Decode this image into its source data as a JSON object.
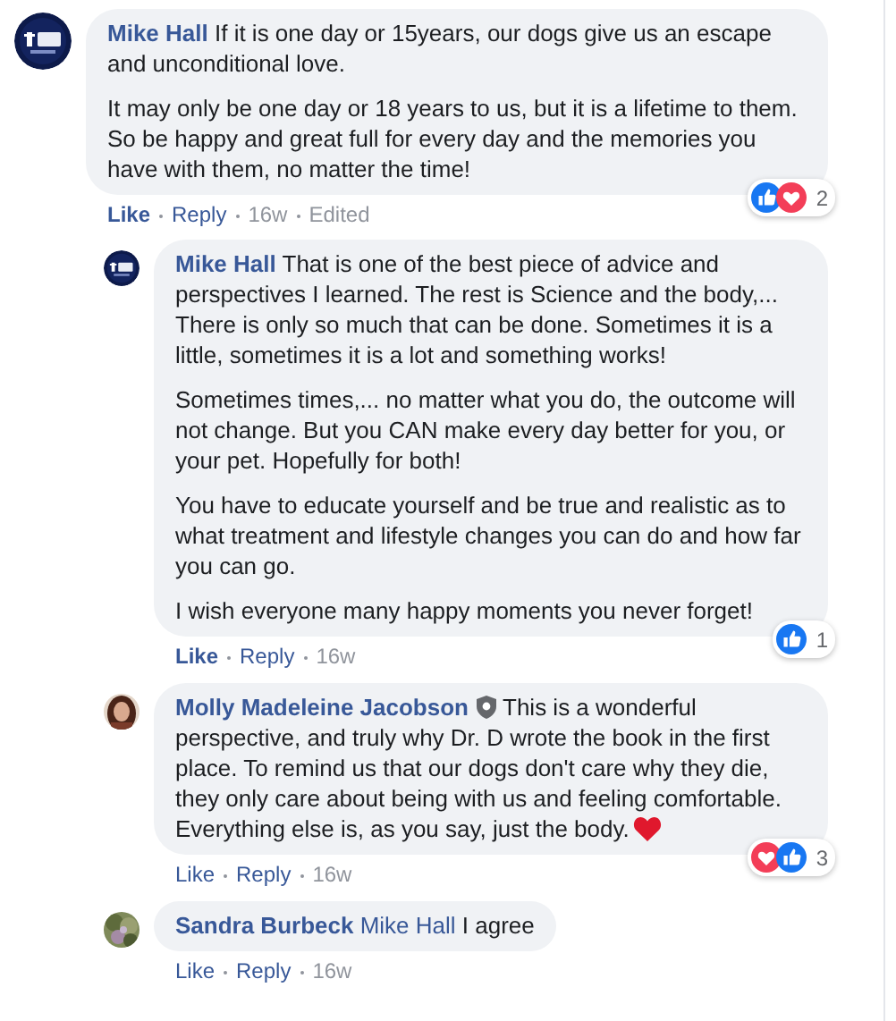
{
  "comments": [
    {
      "author": "Mike Hall",
      "avatar": {
        "kind": "logo"
      },
      "paragraphs": [
        "If it is one day or 15years, our dogs give us an escape and unconditional love.",
        "It may only be one day or 18 years to us, but it is a lifetime to them. So be happy and great full for every day and the memories you have with them, no matter the time!"
      ],
      "reactions": [
        {
          "kind": "like"
        },
        {
          "kind": "love"
        }
      ],
      "reaction_count": "2",
      "like_label": "Like",
      "liked": true,
      "reply_label": "Reply",
      "time": "16w",
      "edited": "Edited",
      "children": [
        {
          "author": "Mike Hall",
          "avatar": {
            "kind": "logo"
          },
          "paragraphs": [
            "That is one of the best piece of advice and perspectives I learned. The rest is Science and the body,... There is only so much that can be done. Sometimes it is a little, sometimes it is a lot and something works!",
            "Sometimes times,... no matter what you do, the outcome will not change. But you CAN make every day better for you, or your pet. Hopefully for both!",
            "You have to educate yourself and be true and realistic as to what treatment and lifestyle changes you can do and how far you can go.",
            "I wish everyone many happy moments you never forget!"
          ],
          "reactions": [
            {
              "kind": "like"
            }
          ],
          "reaction_count": "1",
          "like_label": "Like",
          "liked": true,
          "reply_label": "Reply",
          "time": "16w"
        },
        {
          "author": "Molly Madeleine Jacobson",
          "avatar": {
            "kind": "picture"
          },
          "badge": true,
          "paragraphs": [
            "This is a wonderful perspective, and truly why Dr. D wrote the book in the first place. To remind us that our dogs don't care why they die, they only care about being with us and feeling comfortable. Everything else is, as you say, just the body."
          ],
          "ends_with_heart": true,
          "reactions": [
            {
              "kind": "love"
            },
            {
              "kind": "like"
            }
          ],
          "reaction_count": "3",
          "like_label": "Like",
          "liked": false,
          "reply_label": "Reply",
          "time": "16w"
        },
        {
          "author": "Sandra Burbeck",
          "avatar": {
            "kind": "picture"
          },
          "mention": "Mike Hall",
          "paragraphs": [
            "I agree"
          ],
          "like_label": "Like",
          "liked": false,
          "reply_label": "Reply",
          "time": "16w"
        }
      ]
    }
  ]
}
